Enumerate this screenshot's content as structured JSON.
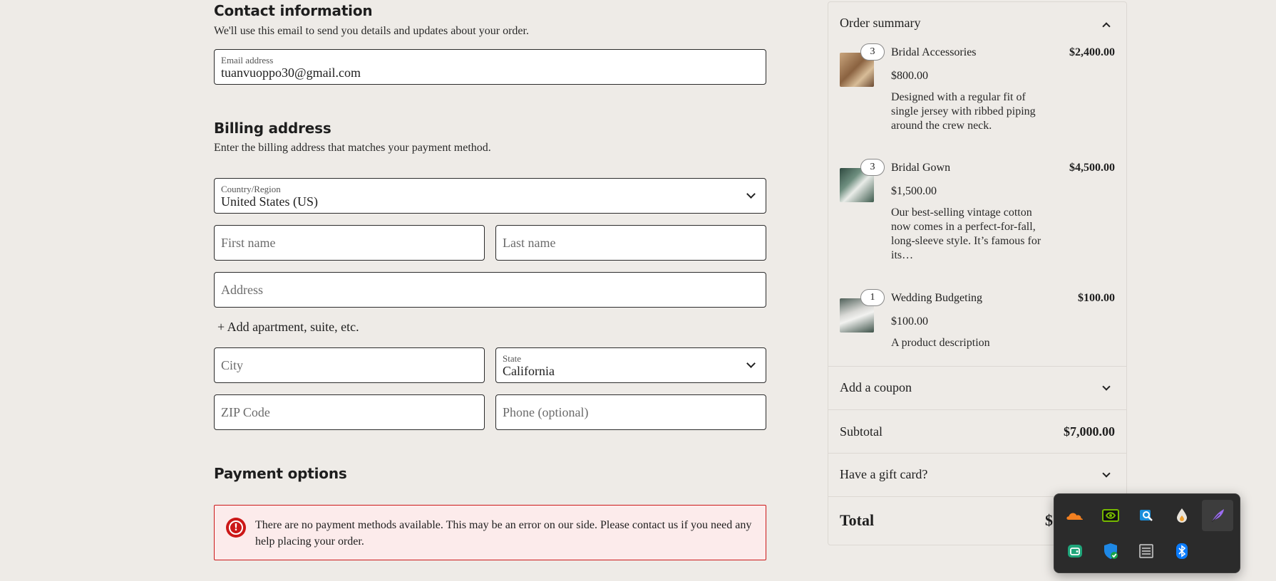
{
  "contact": {
    "heading": "Contact information",
    "description": "We'll use this email to send you details and updates about your order.",
    "email_label": "Email address",
    "email_value": "tuanvuoppo30@gmail.com"
  },
  "billing": {
    "heading": "Billing address",
    "description": "Enter the billing address that matches your payment method.",
    "country_label": "Country/Region",
    "country_value": "United States (US)",
    "first_name_placeholder": "First name",
    "last_name_placeholder": "Last name",
    "address_placeholder": "Address",
    "add_apartment_link": "+ Add apartment, suite, etc.",
    "city_placeholder": "City",
    "state_label": "State",
    "state_value": "California",
    "zip_placeholder": "ZIP Code",
    "phone_placeholder": "Phone (optional)"
  },
  "payment": {
    "heading": "Payment options",
    "notice_text": "There are no payment methods available. This may be an error on our side. Please contact us if you need any help placing your order.",
    "notice_icon": "alert-circle-icon"
  },
  "summary": {
    "title": "Order summary",
    "items": [
      {
        "qty": "3",
        "name": "Bridal Accessories",
        "total": "$2,400.00",
        "price": "$800.00",
        "description": "Designed with a regular fit of single jersey with ribbed piping around the crew neck.",
        "thumb_color": "#a07a52"
      },
      {
        "qty": "3",
        "name": "Bridal Gown",
        "total": "$4,500.00",
        "price": "$1,500.00",
        "description": "Our best-selling vintage cotton now comes in a perfect-for-fall, long-sleeve style. It’s famous for its…",
        "thumb_color": "#4d6b5c"
      },
      {
        "qty": "1",
        "name": "Wedding Budgeting",
        "total": "$100.00",
        "price": "$100.00",
        "description": "A product description",
        "thumb_color": "#586b63"
      }
    ],
    "coupon_label": "Add a coupon",
    "subtotal_label": "Subtotal",
    "subtotal_value": "$7,000.00",
    "gift_card_label": "Have a gift card?",
    "total_label": "Total",
    "total_value_visible": "$"
  },
  "tray": {
    "icons": [
      "cloudflare-icon",
      "nvidia-icon",
      "outlook-search-icon",
      "drop-icon",
      "feather-icon",
      "wallet-app-icon",
      "windows-security-icon",
      "display-adapter-icon",
      "bluetooth-icon"
    ],
    "colors": {
      "cloudflare": "#f38020",
      "nvidia": "#76b900",
      "outlook": "#1a8fdc",
      "feather": "#9b6cf0",
      "wallet": "#1fa57a",
      "security": "#1e88e5",
      "bluetooth": "#0a7cff"
    }
  }
}
